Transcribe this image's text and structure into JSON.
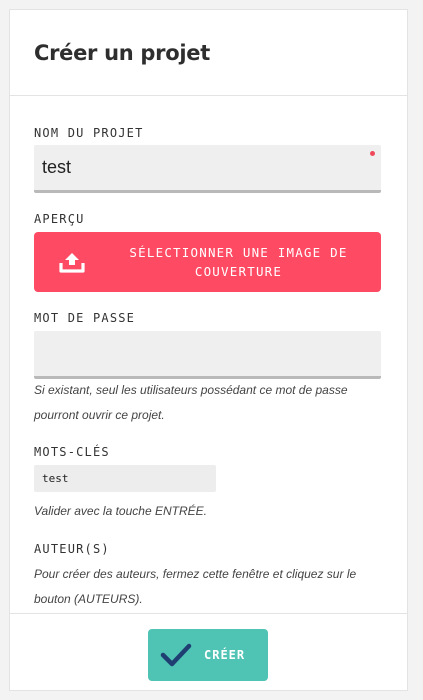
{
  "dialog": {
    "title": "Créer un projet"
  },
  "form": {
    "name": {
      "label": "NOM DU PROJET",
      "value": "test"
    },
    "preview": {
      "label": "APERÇU",
      "button_label": "SÉLECTIONNER UNE IMAGE DE COUVERTURE"
    },
    "password": {
      "label": "MOT DE PASSE",
      "value": "",
      "hint": "Si existant, seul les utilisateurs possédant ce mot de passe pourront ouvrir ce projet."
    },
    "keywords": {
      "label": "MOTS-CLÉS",
      "value": "test",
      "hint": "Valider avec la touche ENTRÉE."
    },
    "authors": {
      "label": "AUTEUR(S)",
      "hint": "Pour créer des auteurs, fermez cette fenêtre et cliquez sur le bouton (AUTEURS)."
    }
  },
  "footer": {
    "create_label": "CRÉER"
  },
  "colors": {
    "upload_button": "#ff4a64",
    "create_button": "#4fc3b4",
    "required_dot": "#ee4a5c",
    "checkmark": "#1f3f73"
  },
  "icons": {
    "upload": "upload-tray-icon",
    "create": "checkmark-icon"
  }
}
